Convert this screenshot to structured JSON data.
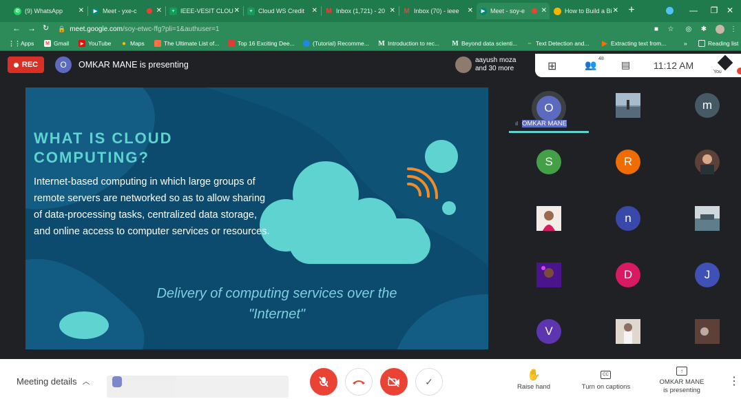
{
  "tabs": [
    {
      "label": "(9) WhatsApp",
      "icon": "whatsapp-icon",
      "color": "#25d366"
    },
    {
      "label": "Meet - yxe-c",
      "icon": "meet-icon",
      "color": "#00897b"
    },
    {
      "label": "IEEE-VESIT CLOU",
      "icon": "sheets-icon",
      "color": "#0f9d58"
    },
    {
      "label": "Cloud WS Credit",
      "icon": "sheets-icon",
      "color": "#0f9d58"
    },
    {
      "label": "Inbox (1,721) - 20",
      "icon": "gmail-icon",
      "color": "#ea4335"
    },
    {
      "label": "Inbox (70) - ieee",
      "icon": "gmail-icon",
      "color": "#ea4335"
    },
    {
      "label": "Meet - soy-e",
      "icon": "meet-icon",
      "color": "#00897b"
    },
    {
      "label": "How to Build a Bi",
      "icon": "page-icon",
      "color": "#f4b400"
    }
  ],
  "url": {
    "host": "meet.google.com",
    "path": "/soy-etwc-ffg?pli=1&authuser=1"
  },
  "bookmarks": [
    {
      "label": "Apps",
      "icon": "apps-icon"
    },
    {
      "label": "Gmail",
      "icon": "gmail-icon"
    },
    {
      "label": "YouTube",
      "icon": "youtube-icon"
    },
    {
      "label": "Maps",
      "icon": "maps-icon"
    },
    {
      "label": "The Ultimate List of...",
      "icon": "bookmark-icon"
    },
    {
      "label": "Top 16 Exciting Dee...",
      "icon": "bookmark-icon"
    },
    {
      "label": "(Tutorial) Recomme...",
      "icon": "bookmark-icon"
    },
    {
      "label": "Introduction to rec...",
      "icon": "medium-icon"
    },
    {
      "label": "Beyond data scienti...",
      "icon": "medium-icon"
    },
    {
      "label": "Text Detection and...",
      "icon": "bookmark-icon"
    },
    {
      "label": "Extracting text from...",
      "icon": "bookmark-icon"
    },
    {
      "label": "Reading list",
      "icon": "reading-list-icon"
    }
  ],
  "meet": {
    "rec_label": "REC",
    "presenter_initial": "O",
    "presenter_text": "OMKAR MANE is presenting",
    "viewers_name": "aayush moza",
    "viewers_more": "and 30 more",
    "people_count": "48",
    "time": "11:12 AM",
    "you_label": "You"
  },
  "slide": {
    "title_line1": "WHAT IS CLOUD",
    "title_line2": "COMPUTING?",
    "body": [
      "Internet-based computing in which large groups of",
      "remote servers are networked so as to allow sharing",
      "of data-processing tasks, centralized data storage,",
      "and online access to computer services or resources."
    ],
    "footer_line1": "Delivery of computing services over the",
    "footer_line2": "\"Internet\""
  },
  "participants": [
    {
      "initial": "O",
      "color": "#5c6bc0",
      "name": "OMKAR MANE",
      "speaking": true
    },
    {
      "initial": "",
      "color": "#7c8fa0",
      "photo": true
    },
    {
      "initial": "m",
      "color": "#455a64"
    },
    {
      "initial": "S",
      "color": "#43a047"
    },
    {
      "initial": "R",
      "color": "#ef6c00"
    },
    {
      "initial": "",
      "color": "#5d4037",
      "photo": true
    },
    {
      "initial": "",
      "color": "#c7a58a",
      "photo": true
    },
    {
      "initial": "n",
      "color": "#3949ab"
    },
    {
      "initial": "",
      "color": "#8e9aa6",
      "photo": true
    },
    {
      "initial": "",
      "color": "#6a1b9a",
      "photo": true
    },
    {
      "initial": "D",
      "color": "#d81b60"
    },
    {
      "initial": "J",
      "color": "#3f51b5"
    },
    {
      "initial": "V",
      "color": "#5e35b1"
    },
    {
      "initial": "",
      "color": "#9e8f80",
      "photo": true
    },
    {
      "initial": "",
      "color": "#6d4c41",
      "photo": true
    }
  ],
  "bottom": {
    "meeting_details": "Meeting details",
    "raise_hand": "Raise hand",
    "captions": "Turn on captions",
    "presenting_line1": "OMKAR MANE",
    "presenting_line2": "is presenting"
  },
  "colors": {
    "mic_off": "#ea4335",
    "slide_bg": "#0c4a6e",
    "teal": "#5fd3d0"
  }
}
